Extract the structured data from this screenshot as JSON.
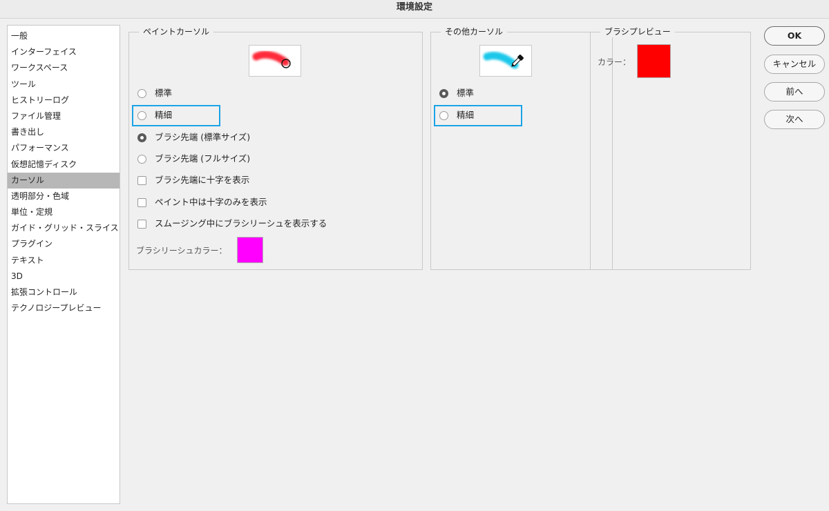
{
  "window": {
    "title": "環境設定"
  },
  "sidebar": {
    "items": [
      {
        "label": "一般"
      },
      {
        "label": "インターフェイス"
      },
      {
        "label": "ワークスペース"
      },
      {
        "label": "ツール"
      },
      {
        "label": "ヒストリーログ"
      },
      {
        "label": "ファイル管理"
      },
      {
        "label": "書き出し"
      },
      {
        "label": "パフォーマンス"
      },
      {
        "label": "仮想記憶ディスク"
      },
      {
        "label": "カーソル",
        "selected": true
      },
      {
        "label": "透明部分・色域"
      },
      {
        "label": "単位・定規"
      },
      {
        "label": "ガイド・グリッド・スライス"
      },
      {
        "label": "プラグイン"
      },
      {
        "label": "テキスト"
      },
      {
        "label": "3D"
      },
      {
        "label": "拡張コントロール"
      },
      {
        "label": "テクノロジープレビュー"
      }
    ]
  },
  "paint_cursor": {
    "title": "ペイントカーソル",
    "options": {
      "standard": "標準",
      "precise": "精細",
      "brush_tip_normal": "ブラシ先端 (標準サイズ)",
      "brush_tip_full": "ブラシ先端 (フルサイズ)"
    },
    "selected": "brush_tip_normal",
    "checkboxes": {
      "show_crosshair_in_tip": "ブラシ先端に十字を表示",
      "only_crosshair_while_painting": "ペイント中は十字のみを表示",
      "show_leash_while_smoothing": "スムージング中にブラシリーシュを表示する"
    },
    "leash_color_label": "ブラシリーシュカラー：",
    "leash_color": "#ff00ff",
    "stroke_color": "#ff2a3a"
  },
  "other_cursors": {
    "title": "その他カーソル",
    "options": {
      "standard": "標準",
      "precise": "精細"
    },
    "selected": "standard",
    "stroke_color": "#1ec8ea"
  },
  "brush_preview": {
    "title": "ブラシプレビュー",
    "color_label": "カラー：",
    "color": "#ff0000"
  },
  "buttons": {
    "ok": "OK",
    "cancel": "キャンセル",
    "prev": "前へ",
    "next": "次へ"
  },
  "colors": {
    "highlight": "#1aa3e6",
    "selected_item": "#b7b7b7"
  }
}
